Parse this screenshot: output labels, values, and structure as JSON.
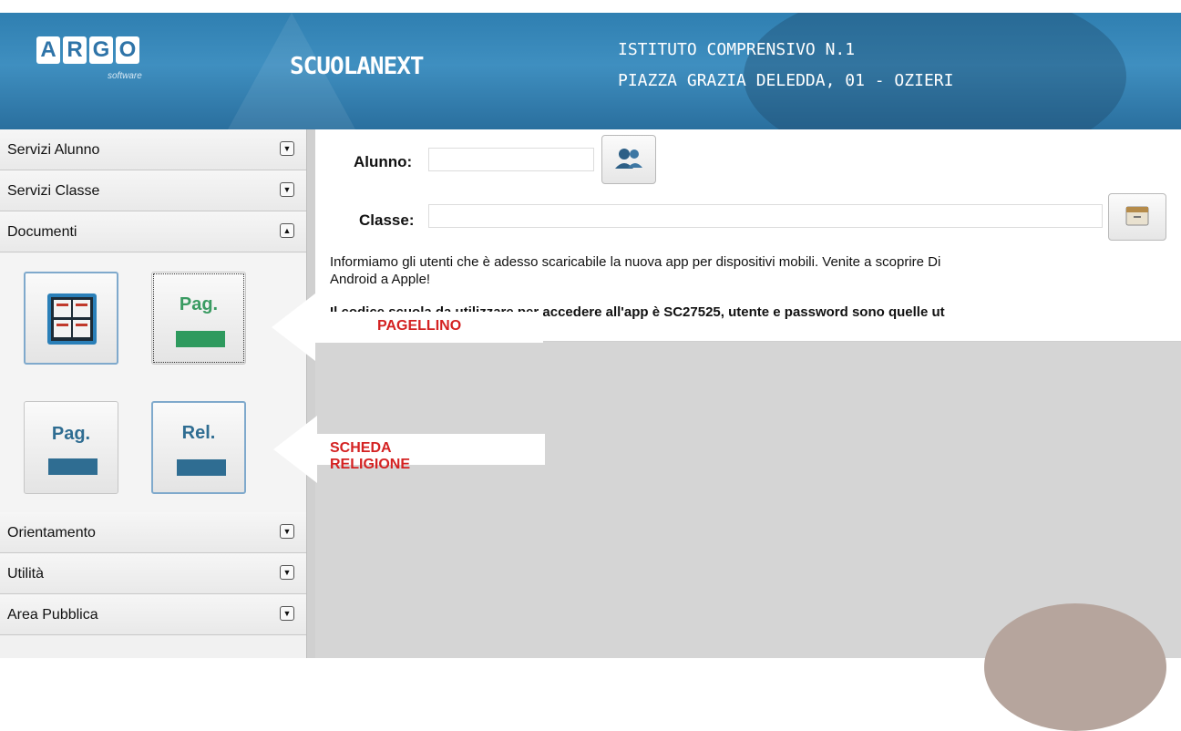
{
  "header": {
    "logo_letters": [
      "A",
      "R",
      "G",
      "O"
    ],
    "logo_sub": "software",
    "brand": "SCUOLANEXT",
    "school_name": "ISTITUTO COMPRENSIVO N.1",
    "school_address": "PIAZZA GRAZIA DELEDDA, 01 - OZIERI"
  },
  "sidebar": {
    "items": [
      {
        "label": "Servizi Alunno",
        "icon": "expand-icon"
      },
      {
        "label": "Servizi Classe",
        "icon": "expand-icon"
      },
      {
        "label": "Documenti",
        "icon": "collapse-icon"
      },
      {
        "label": "Orientamento",
        "icon": "expand-icon"
      },
      {
        "label": "Utilità",
        "icon": "expand-icon"
      },
      {
        "label": "Area Pubblica",
        "icon": "expand-icon"
      }
    ],
    "documenti_tiles": [
      {
        "name": "grid-documents-tile",
        "label": ""
      },
      {
        "name": "pagellino-tile",
        "label": "Pag."
      },
      {
        "name": "pagella-tile",
        "label": "Pag."
      },
      {
        "name": "religione-tile",
        "label": "Rel."
      }
    ]
  },
  "main": {
    "alunno_label": "Alunno:",
    "alunno_value": "",
    "classe_label": "Classe:",
    "classe_value": "",
    "info_line1": "Informiamo gli utenti che è adesso scaricabile la nuova app per dispositivi mobili. Venite a scoprire Di",
    "info_line2": "Android a Apple!",
    "info_line3": "Il codice scuola da utilizzare per accedere all'app è SC27525, utente e password sono quelle ut"
  },
  "annotations": {
    "arrow1": "PAGELLINO",
    "arrow2": "SCHEDA RELIGIONE"
  },
  "colors": {
    "header_blue": "#3f8fc0",
    "tile_green": "#2e9a5e",
    "tile_blue": "#2f6d92",
    "annotation_red": "#d42222"
  }
}
